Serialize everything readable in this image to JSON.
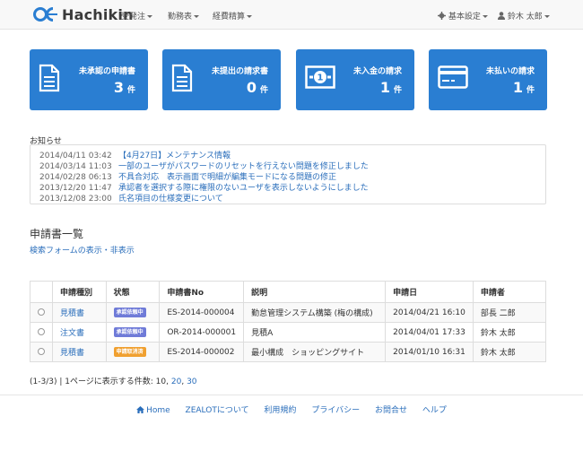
{
  "brand": {
    "name": "Hachikin",
    "logo_color": "#2a7ed2"
  },
  "nav": {
    "left": [
      {
        "label": "受発注"
      },
      {
        "label": "勤務表"
      },
      {
        "label": "経費精算"
      }
    ],
    "settings_label": "基本設定",
    "user_label": "鈴木 太郎"
  },
  "tiles": [
    {
      "title": "未承認の申請書",
      "count": "3",
      "unit": "件",
      "icon": "document-icon"
    },
    {
      "title": "未提出の請求書",
      "count": "0",
      "unit": "件",
      "icon": "document-icon"
    },
    {
      "title": "未入金の請求",
      "count": "1",
      "unit": "件",
      "icon": "banknote-icon"
    },
    {
      "title": "未払いの請求",
      "count": "1",
      "unit": "件",
      "icon": "credit-card-icon"
    }
  ],
  "notices": {
    "label": "お知らせ",
    "items": [
      {
        "date": "2014/04/11 03:42",
        "title": "【4月27日】メンテナンス情報"
      },
      {
        "date": "2014/03/14 11:03",
        "title": "一部のユーザがパスワードのリセットを行えない問題を修正しました"
      },
      {
        "date": "2014/02/28 06:13",
        "title": "不具合対応　表示画面で明細が編集モードになる問題の修正"
      },
      {
        "date": "2013/12/20 11:47",
        "title": "承認者を選択する際に権限のないユーザを表示しないようにしました"
      },
      {
        "date": "2013/12/08 23:00",
        "title": "氏名項目の仕様変更について"
      }
    ]
  },
  "section": {
    "title": "申請書一覧",
    "search_toggle": "検索フォームの表示・非表示"
  },
  "table": {
    "headers": [
      "申請種別",
      "状態",
      "申請書No",
      "説明",
      "申請日",
      "申請者"
    ],
    "rows": [
      {
        "type": "見積書",
        "status": "承認依頼中",
        "status_color": "#6f7bd8",
        "no": "ES-2014-000004",
        "desc": "勤怠管理システム構築 (梅の構成)",
        "date": "2014/04/21 16:10",
        "applicant": "部長 二郎"
      },
      {
        "type": "注文書",
        "status": "承認依頼中",
        "status_color": "#6f7bd8",
        "no": "OR-2014-000001",
        "desc": "見積A",
        "date": "2014/04/01 17:33",
        "applicant": "鈴木 太郎"
      },
      {
        "type": "見積書",
        "status": "申請取消済",
        "status_color": "#f0a030",
        "no": "ES-2014-000002",
        "desc": "最小構成　ショッピングサイト",
        "date": "2014/01/10 16:31",
        "applicant": "鈴木 太郎"
      }
    ]
  },
  "pager": {
    "summary": "(1-3/3) | 1ページに表示する件数: 10,",
    "opt20": "20",
    "comma": ",",
    "opt30": "30"
  },
  "footer": {
    "links": [
      "Home",
      "ZEALOTについて",
      "利用規約",
      "プライバシー",
      "お問合せ",
      "ヘルプ"
    ]
  }
}
